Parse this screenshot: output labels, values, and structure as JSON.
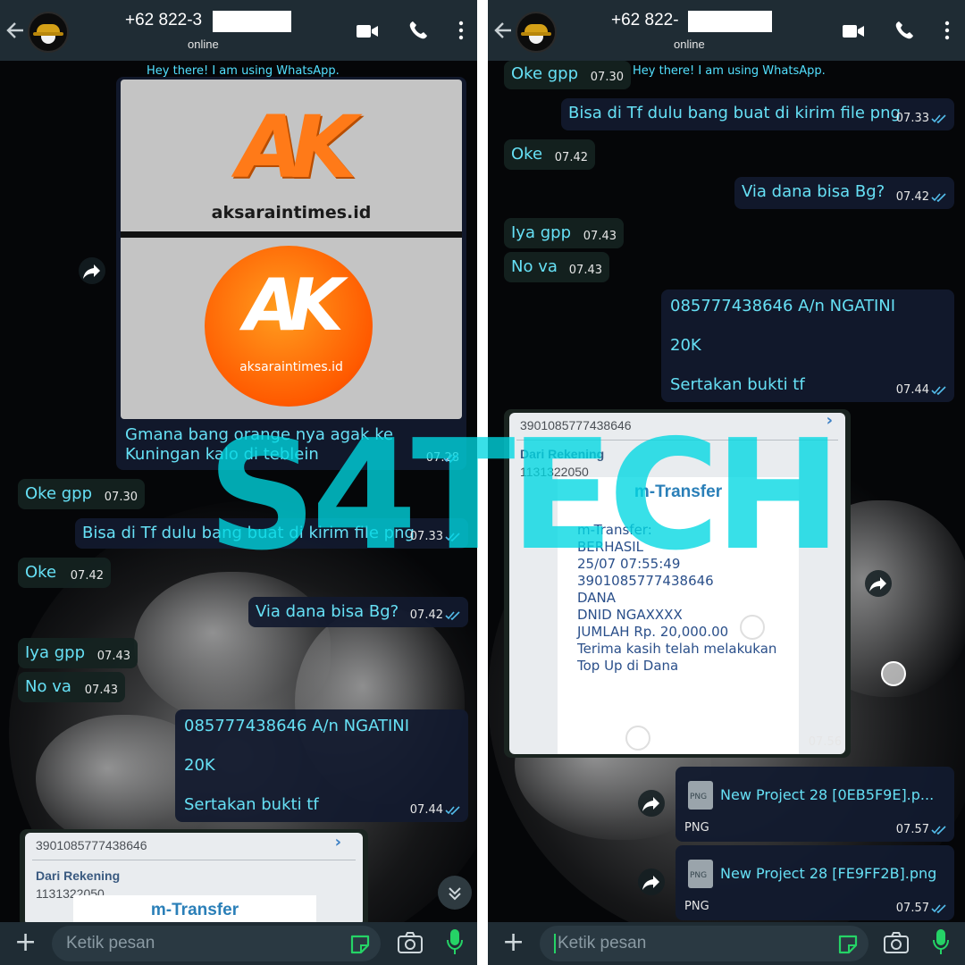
{
  "left": {
    "header": {
      "contact": "+62 822-3",
      "status": "online"
    },
    "about": "Hey there! I am using WhatsApp.",
    "image_card": {
      "brand_top": "aksaraintimes.id",
      "brand_bottom": "aksaraintimes.id",
      "logo": "AK"
    },
    "messages": [
      {
        "text1": "Gmana bang orange nya agak ke",
        "text2": "Kuningan kalo di teblein",
        "time": "07.28"
      },
      {
        "text": "Oke gpp",
        "time": "07.30"
      },
      {
        "text": "Bisa di Tf dulu bang buat di kirim file png",
        "time": "07.33"
      },
      {
        "text": "Oke",
        "time": "07.42"
      },
      {
        "text": "Via dana bisa Bg?",
        "time": "07.42"
      },
      {
        "text": "Iya gpp",
        "time": "07.43"
      },
      {
        "text": "No va",
        "time": "07.43"
      },
      {
        "line1": "085777438646 A/n NGATINI",
        "line2": "20K",
        "line3": "Sertakan bukti tf",
        "time": "07.44"
      }
    ],
    "receipt": {
      "account": "3901085777438646",
      "from_label": "Dari Rekening",
      "from_value": "1131322050",
      "title": "m-Transfer"
    },
    "input_placeholder": "Ketik pesan"
  },
  "right": {
    "header": {
      "contact": "+62 822-",
      "status": "online"
    },
    "about": "Hey there! I am using WhatsApp.",
    "messages": [
      {
        "text": "Oke gpp",
        "time": "07.30"
      },
      {
        "text": "Bisa di Tf dulu bang buat di kirim file png",
        "time": "07.33"
      },
      {
        "text": "Oke",
        "time": "07.42"
      },
      {
        "text": "Via dana bisa Bg?",
        "time": "07.42"
      },
      {
        "text": "Iya gpp",
        "time": "07.43"
      },
      {
        "text": "No va",
        "time": "07.43"
      },
      {
        "line1": "085777438646 A/n NGATINI",
        "line2": "20K",
        "line3": "Sertakan bukti tf",
        "time": "07.44"
      }
    ],
    "receipt": {
      "account": "3901085777438646",
      "from_label": "Dari Rekening",
      "from_value": "1131322050",
      "title": "m-Transfer",
      "body": "m-Transfer:\nBERHASIL\n25/07 07:55:49\n3901085777438646\nDANA\nDNID NGAXXXX\nJUMLAH Rp. 20,000.00\nTerima kasih telah melakukan\nTop Up di Dana",
      "time": "07.56"
    },
    "files": [
      {
        "name": "New Project 28 [0EB5F9E].p...",
        "type": "PNG",
        "icon_label": "PNG",
        "time": "07.57"
      },
      {
        "name": "New Project 28 [FE9FF2B].png",
        "type": "PNG",
        "icon_label": "PNG",
        "time": "07.57"
      }
    ],
    "input_placeholder": "Ketik pesan"
  },
  "watermark": "S4TECH",
  "colors": {
    "header": "#1f2c34",
    "message_text": "#66e0f5",
    "tick": "#53bdeb",
    "watermark": "#00d7e1"
  },
  "icons": [
    "back-arrow-icon",
    "video-call-icon",
    "phone-icon",
    "more-vert-icon",
    "forward-icon",
    "plus-icon",
    "sticker-icon",
    "camera-icon",
    "mic-icon",
    "double-check-icon",
    "scroll-down-icon"
  ]
}
